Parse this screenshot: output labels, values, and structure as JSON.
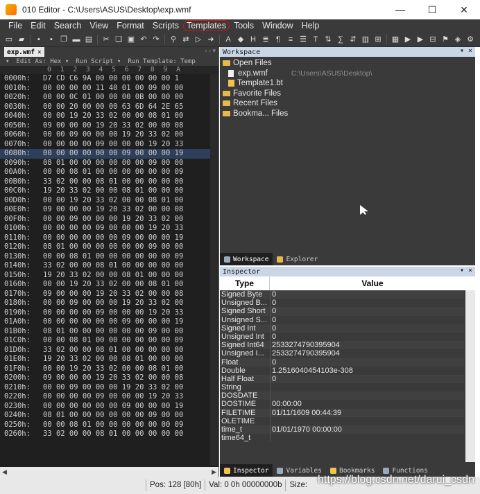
{
  "window": {
    "title": "010 Editor - C:\\Users\\ASUS\\Desktop\\exp.wmf",
    "minimize": "—",
    "maximize": "☐",
    "close": "✕"
  },
  "menu": [
    "File",
    "Edit",
    "Search",
    "View",
    "Format",
    "Scripts",
    "Templates",
    "Tools",
    "Window",
    "Help"
  ],
  "editor": {
    "tab_label": "exp.wmf",
    "tab_close": "×",
    "tab_nav": "‹ › ▾",
    "subbar": [
      "▾",
      "Edit As: Hex ▾",
      "Run Script ▾",
      "Run Template: Temp"
    ],
    "columns": [
      "0",
      "1",
      "2",
      "3",
      "4",
      "5",
      "6",
      "7",
      "8",
      "9",
      "A"
    ],
    "rows": [
      {
        "addr": "0000h:",
        "bytes": "D7 CD C6 9A 00 00 00 00 00 00 1"
      },
      {
        "addr": "0010h:",
        "bytes": "00 00 00 00 11 40 01 00 09 00 00"
      },
      {
        "addr": "0020h:",
        "bytes": "00 00 0C 01 00 00 00 0B 00 00 00"
      },
      {
        "addr": "0030h:",
        "bytes": "00 00 20 00 00 00 63 6D 64 2E 65"
      },
      {
        "addr": "0040h:",
        "bytes": "00 00 19 20 33 02 00 00 08 01 00"
      },
      {
        "addr": "0050h:",
        "bytes": "09 00 00 00 19 20 33 02 00 00 08"
      },
      {
        "addr": "0060h:",
        "bytes": "00 00 09 00 00 00 19 20 33 02 00"
      },
      {
        "addr": "0070h:",
        "bytes": "00 00 00 00 09 00 00 00 19 20 33"
      },
      {
        "addr": "0080h:",
        "bytes": "00 00 00 00 00 00 09 00 00 00 19"
      },
      {
        "addr": "0090h:",
        "bytes": "08 01 00 00 00 00 00 00 09 00 00"
      },
      {
        "addr": "00A0h:",
        "bytes": "00 00 08 01 00 00 00 00 00 00 09"
      },
      {
        "addr": "00B0h:",
        "bytes": "33 02 00 00 08 01 00 00 00 00 00"
      },
      {
        "addr": "00C0h:",
        "bytes": "19 20 33 02 00 00 08 01 00 00 00"
      },
      {
        "addr": "00D0h:",
        "bytes": "00 00 19 20 33 02 00 00 08 01 00"
      },
      {
        "addr": "00E0h:",
        "bytes": "09 00 00 00 19 20 33 02 00 00 08"
      },
      {
        "addr": "00F0h:",
        "bytes": "00 00 09 00 00 00 19 20 33 02 00"
      },
      {
        "addr": "0100h:",
        "bytes": "00 00 00 00 09 00 00 00 19 20 33"
      },
      {
        "addr": "0110h:",
        "bytes": "00 00 00 00 00 00 09 00 00 00 19"
      },
      {
        "addr": "0120h:",
        "bytes": "08 01 00 00 00 00 00 00 09 00 00"
      },
      {
        "addr": "0130h:",
        "bytes": "00 00 08 01 00 00 00 00 00 00 09"
      },
      {
        "addr": "0140h:",
        "bytes": "33 02 00 00 08 01 00 00 00 00 00"
      },
      {
        "addr": "0150h:",
        "bytes": "19 20 33 02 00 00 08 01 00 00 00"
      },
      {
        "addr": "0160h:",
        "bytes": "00 00 19 20 33 02 00 00 08 01 00"
      },
      {
        "addr": "0170h:",
        "bytes": "09 00 00 00 19 20 33 02 00 00 08"
      },
      {
        "addr": "0180h:",
        "bytes": "00 00 09 00 00 00 19 20 33 02 00"
      },
      {
        "addr": "0190h:",
        "bytes": "00 00 00 00 09 00 00 00 19 20 33"
      },
      {
        "addr": "01A0h:",
        "bytes": "00 00 00 00 00 00 09 00 00 00 19"
      },
      {
        "addr": "01B0h:",
        "bytes": "08 01 00 00 00 00 00 00 09 00 00"
      },
      {
        "addr": "01C0h:",
        "bytes": "00 00 08 01 00 00 00 00 00 00 09"
      },
      {
        "addr": "01D0h:",
        "bytes": "33 02 00 00 08 01 00 00 00 00 00"
      },
      {
        "addr": "01E0h:",
        "bytes": "19 20 33 02 00 00 08 01 00 00 00"
      },
      {
        "addr": "01F0h:",
        "bytes": "00 00 19 20 33 02 00 00 08 01 00"
      },
      {
        "addr": "0200h:",
        "bytes": "09 00 00 00 19 20 33 02 00 00 08"
      },
      {
        "addr": "0210h:",
        "bytes": "00 00 09 00 00 00 19 20 33 02 00"
      },
      {
        "addr": "0220h:",
        "bytes": "00 00 00 00 09 00 00 00 19 20 33"
      },
      {
        "addr": "0230h:",
        "bytes": "00 00 00 00 00 00 09 00 00 00 19"
      },
      {
        "addr": "0240h:",
        "bytes": "08 01 00 00 00 00 00 00 09 00 00"
      },
      {
        "addr": "0250h:",
        "bytes": "00 00 08 01 00 00 00 00 00 00 09"
      },
      {
        "addr": "0260h:",
        "bytes": "33 02 00 00 08 01 00 00 00 00 00"
      }
    ],
    "highlighted_row": 8
  },
  "workspace": {
    "header": "Workspace",
    "open_files": "Open Files",
    "file1": "exp.wmf",
    "file1_path": "C:\\Users\\ASUS\\Desktop\\",
    "file2": "Template1.bt",
    "favorite_files": "Favorite Files",
    "recent_files": "Recent Files",
    "bookmarked_files": "Bookma... Files",
    "tab_workspace": "Workspace",
    "tab_explorer": "Explorer"
  },
  "inspector": {
    "header": "Inspector",
    "col_type": "Type",
    "col_value": "Value",
    "rows": [
      {
        "type": "Signed Byte",
        "value": "0"
      },
      {
        "type": "Unsigned B...",
        "value": "0"
      },
      {
        "type": "Signed Short",
        "value": "0"
      },
      {
        "type": "Unsigned S...",
        "value": "0"
      },
      {
        "type": "Signed Int",
        "value": "0"
      },
      {
        "type": "Unsigned Int",
        "value": "0"
      },
      {
        "type": "Signed Int64",
        "value": "2533274790395904"
      },
      {
        "type": "Unsigned I...",
        "value": "2533274790395904"
      },
      {
        "type": "Float",
        "value": "0"
      },
      {
        "type": "Double",
        "value": "1.2516040454103e-308"
      },
      {
        "type": "Half Float",
        "value": "0"
      },
      {
        "type": "String",
        "value": ""
      },
      {
        "type": "DOSDATE",
        "value": ""
      },
      {
        "type": "DOSTIME",
        "value": "00:00:00"
      },
      {
        "type": "FILETIME",
        "value": "01/11/1609 00:44:39"
      },
      {
        "type": "OLETIME",
        "value": ""
      },
      {
        "type": "time_t",
        "value": "01/01/1970 00:00:00"
      },
      {
        "type": "time64_t",
        "value": ""
      }
    ],
    "tabs": [
      "Inspector",
      "Variables",
      "Bookmarks",
      "Functions"
    ]
  },
  "status": {
    "pos": "Pos: 128 [80h]",
    "val": "Val: 0 0h 00000000b",
    "size": "Size:"
  },
  "watermark": "https://blog.csdn.net/darui_csdn"
}
